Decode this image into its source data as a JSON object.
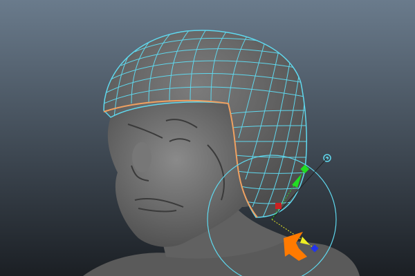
{
  "viewport": {
    "background_top": "#6a7b8c",
    "background_bottom": "#1b1f24",
    "model_color": "#6e6e6e",
    "wire_color": "#5fd8ee",
    "selection_border_color": "#f0a060"
  },
  "manipulator": {
    "icons": [
      "rotate-ring-icon",
      "move-handle-y-icon",
      "scale-handle-y-icon",
      "scale-handle-x-icon",
      "move-handle-z-icon",
      "scale-handle-z-icon",
      "pivot-icon"
    ],
    "y_color": "#22dd22",
    "x_color": "#cc2222",
    "z_color": "#2233ee",
    "arrow_color": "#eeee22"
  },
  "annotation": {
    "icon": "pointer-arrow-icon",
    "color": "#ff7a00"
  }
}
